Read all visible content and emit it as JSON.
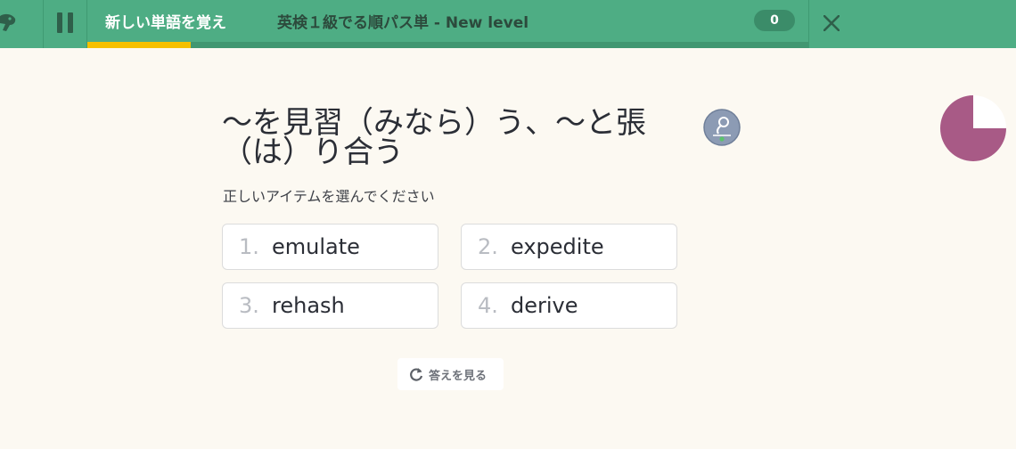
{
  "header": {
    "mode_label": "新しい単語を覚え",
    "course_title": "英検１級でる順パス単 - New level",
    "score": "0",
    "progress_fraction": 0.144,
    "colors": {
      "bar": "#4ead84",
      "progress_fill": "#f5c000"
    },
    "icons": [
      "logo-icon",
      "pause-icon",
      "close-icon"
    ]
  },
  "question": {
    "prompt": "～を見習（みなら）う、～と張（は）り合う",
    "instruction": "正しいアイテムを選んでください",
    "audio_icon": "mem-audio-icon"
  },
  "options": [
    {
      "number": "1.",
      "word": "emulate"
    },
    {
      "number": "2.",
      "word": "expedite"
    },
    {
      "number": "3.",
      "word": "rehash"
    },
    {
      "number": "4.",
      "word": "derive"
    }
  ],
  "reveal": {
    "label": "答えを見る",
    "icon": "refresh-icon"
  },
  "timer": {
    "elapsed_fraction": 0.75,
    "color": "#a85a86"
  }
}
